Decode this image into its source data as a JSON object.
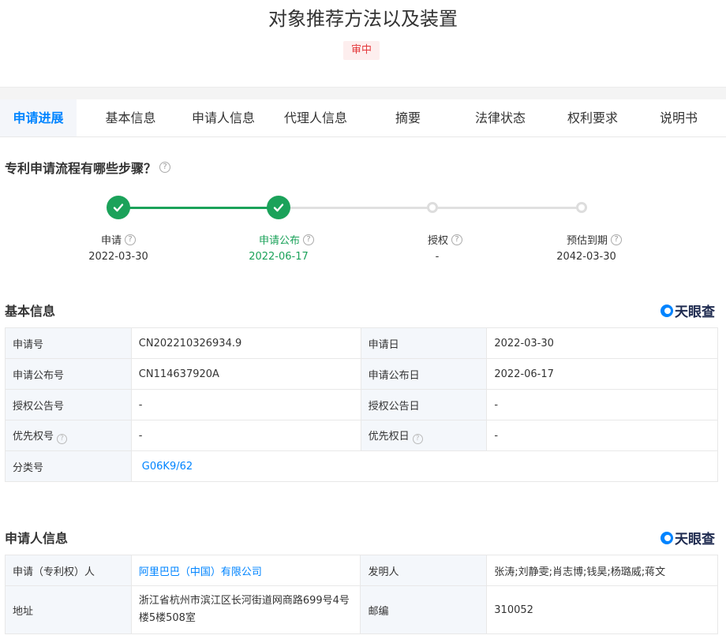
{
  "page": {
    "title": "对象推荐方法以及装置",
    "status": "审中"
  },
  "tabs": [
    "申请进展",
    "基本信息",
    "申请人信息",
    "代理人信息",
    "摘要",
    "法律状态",
    "权利要求",
    "说明书"
  ],
  "process": {
    "title": "专利申请流程有哪些步骤？",
    "help": "?",
    "steps": [
      {
        "label": "申请",
        "date": "2022-03-30",
        "done": true
      },
      {
        "label": "申请公布",
        "date": "2022-06-17",
        "done": true
      },
      {
        "label": "授权",
        "date": "-",
        "done": false
      },
      {
        "label": "预估到期",
        "date": "2042-03-30",
        "done": false
      }
    ]
  },
  "basic_info": {
    "title": "基本信息",
    "logo": "天眼查",
    "rows": [
      {
        "k1": "申请号",
        "v1": "CN202210326934.9",
        "k2": "申请日",
        "v2": "2022-03-30"
      },
      {
        "k1": "申请公布号",
        "v1": "CN114637920A",
        "k2": "申请公布日",
        "v2": "2022-06-17"
      },
      {
        "k1": "授权公告号",
        "v1": "-",
        "k2": "授权公告日",
        "v2": "-"
      },
      {
        "k1": "优先权号",
        "v1": "-",
        "k2": "优先权日",
        "v2": "-"
      }
    ],
    "class_label": "分类号",
    "class_value": "G06K9/62"
  },
  "applicant_info": {
    "title": "申请人信息",
    "logo": "天眼查",
    "applicant_label": "申请（专利权）人",
    "applicant_value": "阿里巴巴（中国）有限公司",
    "inventor_label": "发明人",
    "inventor_value": "张涛;刘静雯;肖志博;钱昊;杨璐威;蒋文",
    "address_label": "地址",
    "address_value": "浙江省杭州市滨江区长河街道网商路699号4号楼5楼508室",
    "postcode_label": "邮编",
    "postcode_value": "310052"
  },
  "colors": {
    "accent": "#0084ff",
    "done": "#1ba25a",
    "status_red": "#e4393c"
  }
}
